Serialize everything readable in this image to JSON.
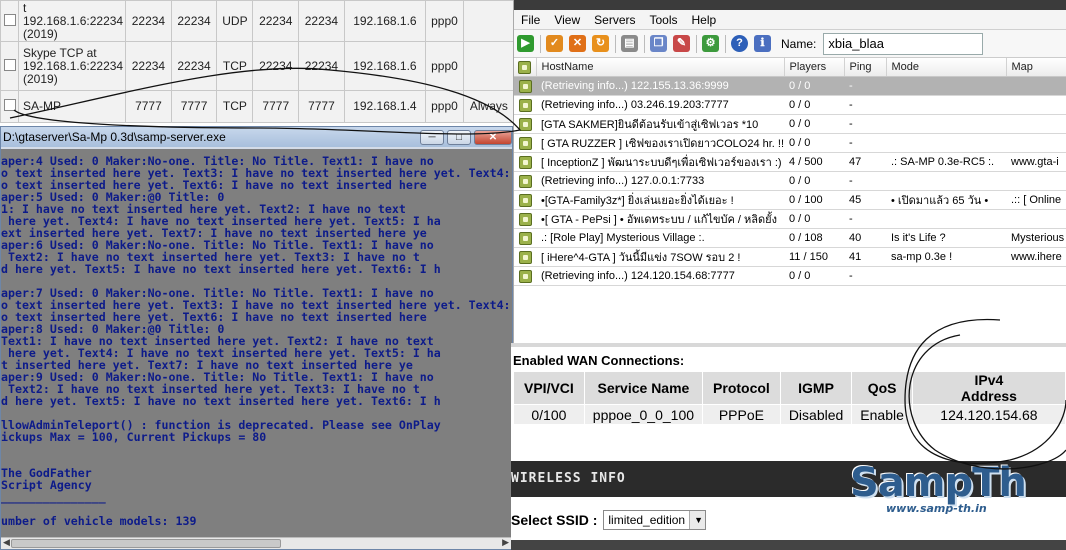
{
  "port_forward": {
    "rows": [
      {
        "name": "t 192.168.1.6:22234 (2019)",
        "ext_start": "22234",
        "ext_end": "22234",
        "protocol": "UDP",
        "int_start": "22234",
        "int_end": "22234",
        "ip": "192.168.1.6",
        "iface": "ppp0",
        "schedule": ""
      },
      {
        "name": "Skype TCP at 192.168.1.6:22234 (2019)",
        "ext_start": "22234",
        "ext_end": "22234",
        "protocol": "TCP",
        "int_start": "22234",
        "int_end": "22234",
        "ip": "192.168.1.6",
        "iface": "ppp0",
        "schedule": ""
      },
      {
        "name": "SA-MP",
        "ext_start": "7777",
        "ext_end": "7777",
        "protocol": "TCP",
        "int_start": "7777",
        "int_end": "7777",
        "ip": "192.168.1.4",
        "iface": "ppp0",
        "schedule": "Always"
      }
    ]
  },
  "console": {
    "title": "D:\\gtaserver\\Sa-Mp 0.3d\\samp-server.exe",
    "lines": [
      "aper:4 Used: 0 Maker:No-one. Title: No Title. Text1: I have no",
      "o text inserted here yet. Text3: I have no text inserted here yet. Text4:",
      "o text inserted here yet. Text6: I have no text inserted here",
      "aper:5 Used: 0 Maker:@0 Title: 0",
      "1: I have no text inserted here yet. Text2: I have no text",
      " here yet. Text4: I have no text inserted here yet. Text5: I ha",
      "ext inserted here yet. Text7: I have no text inserted here ye",
      "aper:6 Used: 0 Maker:No-one. Title: No Title. Text1: I have no",
      " Text2: I have no text inserted here yet. Text3: I have no t",
      "d here yet. Text5: I have no text inserted here yet. Text6: I h",
      "",
      "aper:7 Used: 0 Maker:No-one. Title: No Title. Text1: I have no",
      "o text inserted here yet. Text3: I have no text inserted here yet. Text4:",
      "o text inserted here yet. Text6: I have no text inserted here",
      "aper:8 Used: 0 Maker:@0 Title: 0",
      "Text1: I have no text inserted here yet. Text2: I have no text",
      " here yet. Text4: I have no text inserted here yet. Text5: I ha",
      "t inserted here yet. Text7: I have no text inserted here ye",
      "aper:9 Used: 0 Maker:No-one. Title: No Title. Text1: I have no",
      " Text2: I have no text inserted here yet. Text3: I have no t",
      "d here yet. Text5: I have no text inserted here yet. Text6: I h",
      "",
      "llowAdminTeleport() : function is deprecated. Please see OnPlay",
      "ickups Max = 100, Current Pickups = 80",
      "",
      "",
      "The GodFather",
      "Script Agency",
      "_______________",
      "",
      "umber of vehicle models: 139"
    ]
  },
  "server_browser": {
    "menu": [
      "File",
      "View",
      "Servers",
      "Tools",
      "Help"
    ],
    "name_label": "Name:",
    "name_value": "xbia_blaa",
    "columns": [
      "HostName",
      "Players",
      "Ping",
      "Mode",
      "Map"
    ],
    "rows": [
      {
        "host": "(Retrieving info...) 122.155.13.36:9999",
        "players": "0 / 0",
        "ping": "-",
        "mode": "",
        "map": "",
        "selected": true
      },
      {
        "host": "(Retrieving info...) 03.246.19.203:7777",
        "players": "0 / 0",
        "ping": "-",
        "mode": "",
        "map": ""
      },
      {
        "host": "[GTA SAKMER]ยินดีต้อนรับเข้าสู่เซิฟเวอร *10",
        "players": "0 / 0",
        "ping": "-",
        "mode": "",
        "map": ""
      },
      {
        "host": "[ GTA RUZZER ] เซิฟของเราเปิดยาวCOLO24 hr. !!",
        "players": "0 / 0",
        "ping": "-",
        "mode": "",
        "map": ""
      },
      {
        "host": "[ InceptionZ ] พัฒนาระบบดีๆเพื่อเซิฟเวอร์ของเรา :)",
        "players": "4 / 500",
        "ping": "47",
        "mode": ".: SA-MP 0.3e-RC5 :.",
        "map": "www.gta-i"
      },
      {
        "host": "(Retrieving info...) 127.0.0.1:7733",
        "players": "0 / 0",
        "ping": "-",
        "mode": "",
        "map": ""
      },
      {
        "host": "•[GTA-Family3z*] ยิ่งเล่นเยอะยิ่งได้เยอะ !",
        "players": "0 / 100",
        "ping": "45",
        "mode": "• เปิดมาแล้ว 65 วัน •",
        "map": ".:: [ Online"
      },
      {
        "host": "•[ GTA - PePsi ] • อัพเดทระบบ / แก้ไขบัค / หลิดยั้ง",
        "players": "0 / 0",
        "ping": "-",
        "mode": "",
        "map": ""
      },
      {
        "host": ".: [Role Play] Mysterious Village :.",
        "players": "0 / 108",
        "ping": "40",
        "mode": "Is it's Life ?",
        "map": "Mysterious"
      },
      {
        "host": "[ iHere^4-GTA ] วันนี้มีแข่ง 7SOW รอบ 2 !",
        "players": "11 / 150",
        "ping": "41",
        "mode": "sa-mp 0.3e !",
        "map": "www.ihere"
      },
      {
        "host": "(Retrieving info...) 124.120.154.68:7777",
        "players": "0 / 0",
        "ping": "-",
        "mode": "",
        "map": ""
      }
    ]
  },
  "wan": {
    "heading": "Enabled WAN Connections:",
    "columns": [
      "VPI/VCI",
      "Service Name",
      "Protocol",
      "IGMP",
      "QoS",
      "IPv4 Address"
    ],
    "row": [
      "0/100",
      "pppoe_0_0_100",
      "PPPoE",
      "Disabled",
      "Enable",
      "124.120.154.68"
    ],
    "wireless_title": "WIRELESS INFO",
    "ssid_label": "Select SSID :",
    "ssid_value": "limited_edition"
  },
  "watermark": {
    "logo": "SampTh",
    "url": "www.samp-th.in"
  },
  "colors": {
    "console_bg": "#7f7f7f",
    "console_text": "#0d1b8a",
    "selected_row": "#b2b2b2",
    "lock_icon": "#9bb14a",
    "logo": "#2e5d8e"
  }
}
